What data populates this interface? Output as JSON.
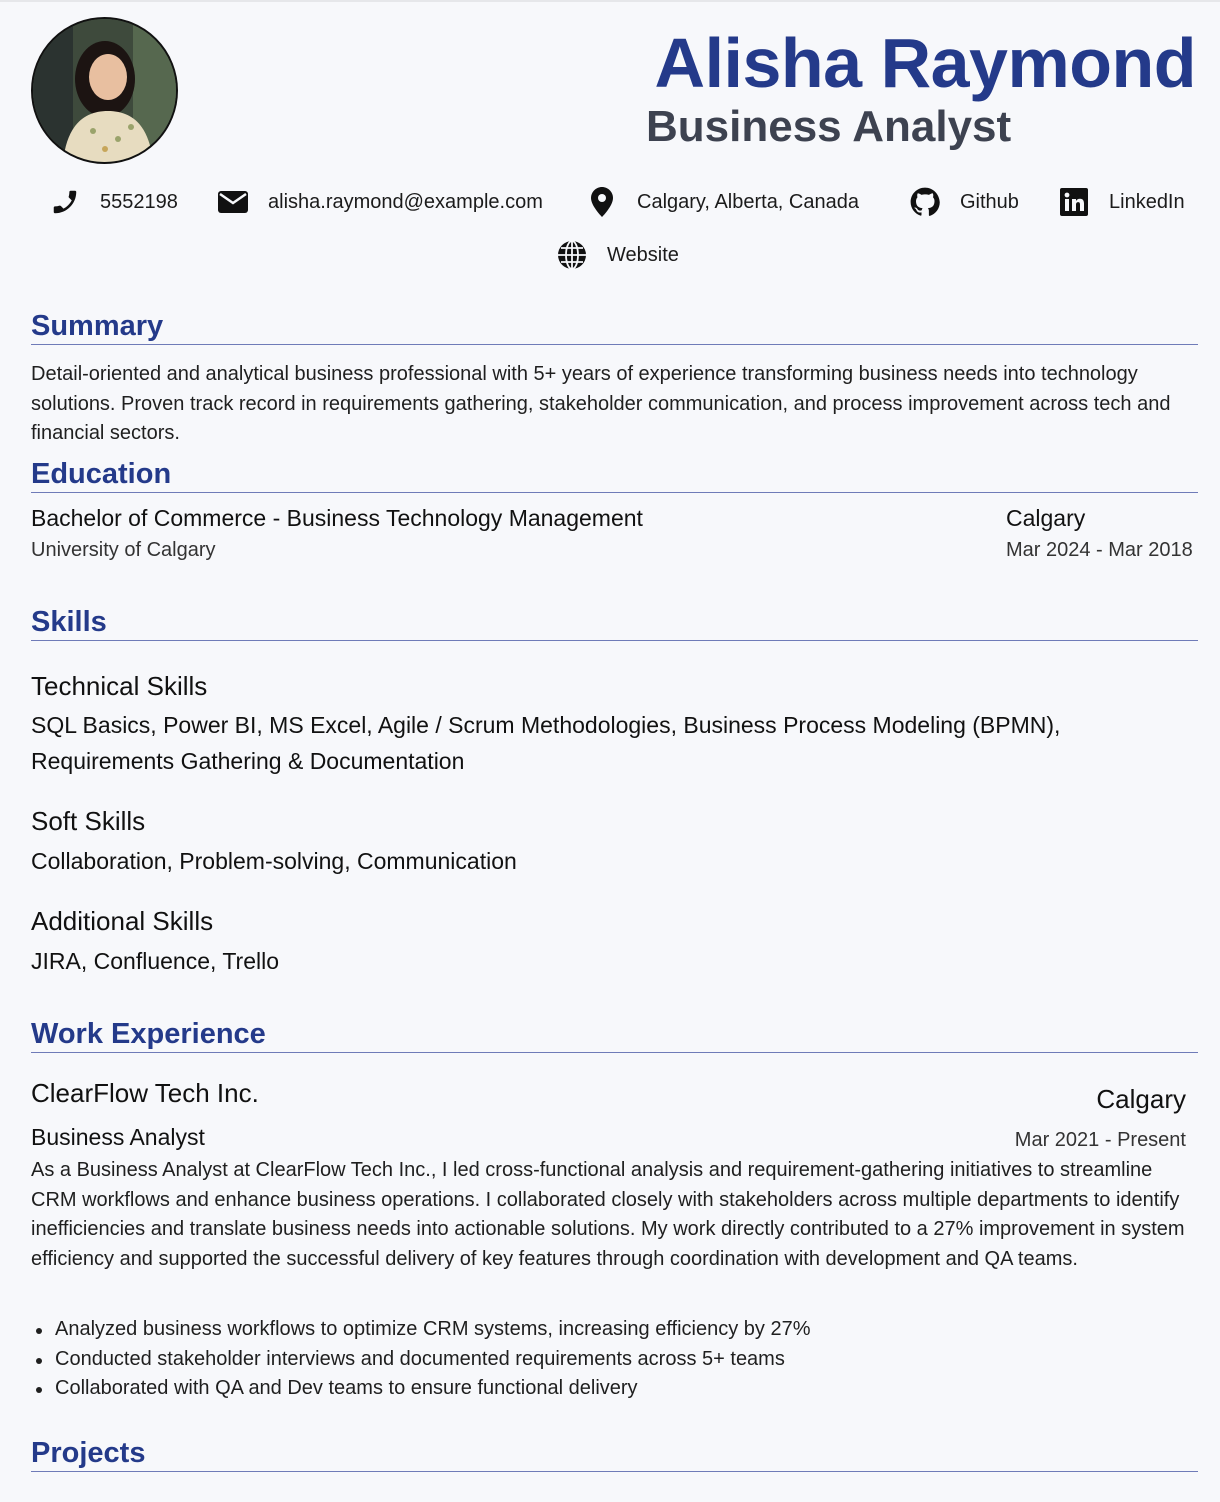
{
  "header": {
    "name": "Alisha Raymond",
    "title": "Business Analyst",
    "avatar_icon": "portrait-photo"
  },
  "contacts": [
    {
      "icon": "phone-icon",
      "text": "5552198"
    },
    {
      "icon": "envelope-icon",
      "text": "alisha.raymond@example.com"
    },
    {
      "icon": "map-pin-icon",
      "text": "Calgary, Alberta, Canada"
    },
    {
      "icon": "github-icon",
      "text": "Github"
    },
    {
      "icon": "linkedin-icon",
      "text": "LinkedIn"
    },
    {
      "icon": "globe-icon",
      "text": "Website"
    }
  ],
  "summary": {
    "heading": "Summary",
    "text": "Detail-oriented and analytical business professional with 5+ years of experience transforming business needs into technology solutions. Proven track record in requirements gathering, stakeholder communication, and process improvement across tech and financial sectors."
  },
  "education": {
    "heading": "Education",
    "degree": "Bachelor of Commerce - Business Technology Management",
    "school": "University of Calgary",
    "location": "Calgary",
    "dates": "Mar 2024 - Mar 2018"
  },
  "skills": {
    "heading": "Skills",
    "groups": [
      {
        "name": "Technical Skills",
        "items": "SQL Basics, Power BI, MS Excel, Agile / Scrum Methodologies, Business Process Modeling (BPMN), Requirements Gathering & Documentation"
      },
      {
        "name": "Soft Skills",
        "items": "Collaboration, Problem-solving, Communication"
      },
      {
        "name": "Additional Skills",
        "items": "JIRA, Confluence, Trello"
      }
    ]
  },
  "work": {
    "heading": "Work Experience",
    "company": "ClearFlow Tech Inc.",
    "location": "Calgary",
    "role": "Business Analyst",
    "dates": "Mar 2021 - Present",
    "description": "As a Business Analyst at ClearFlow Tech Inc., I led cross-functional analysis and requirement-gathering initiatives to streamline CRM workflows and enhance business operations. I collaborated closely with stakeholders across multiple departments to identify inefficiencies and translate business needs into actionable solutions. My work directly contributed to a 27% improvement in system efficiency and supported the successful delivery of key features through coordination with development and QA teams.",
    "bullets": [
      "Analyzed business workflows to optimize CRM systems, increasing efficiency by 27%",
      "Conducted stakeholder interviews and documented requirements across 5+ teams",
      "Collaborated with QA and Dev teams to ensure functional delivery"
    ]
  },
  "projects": {
    "heading": "Projects"
  },
  "colors": {
    "accent": "#243a8a",
    "title": "#3d4250",
    "rule": "#6f7bb8",
    "background": "#f7f8fb"
  }
}
